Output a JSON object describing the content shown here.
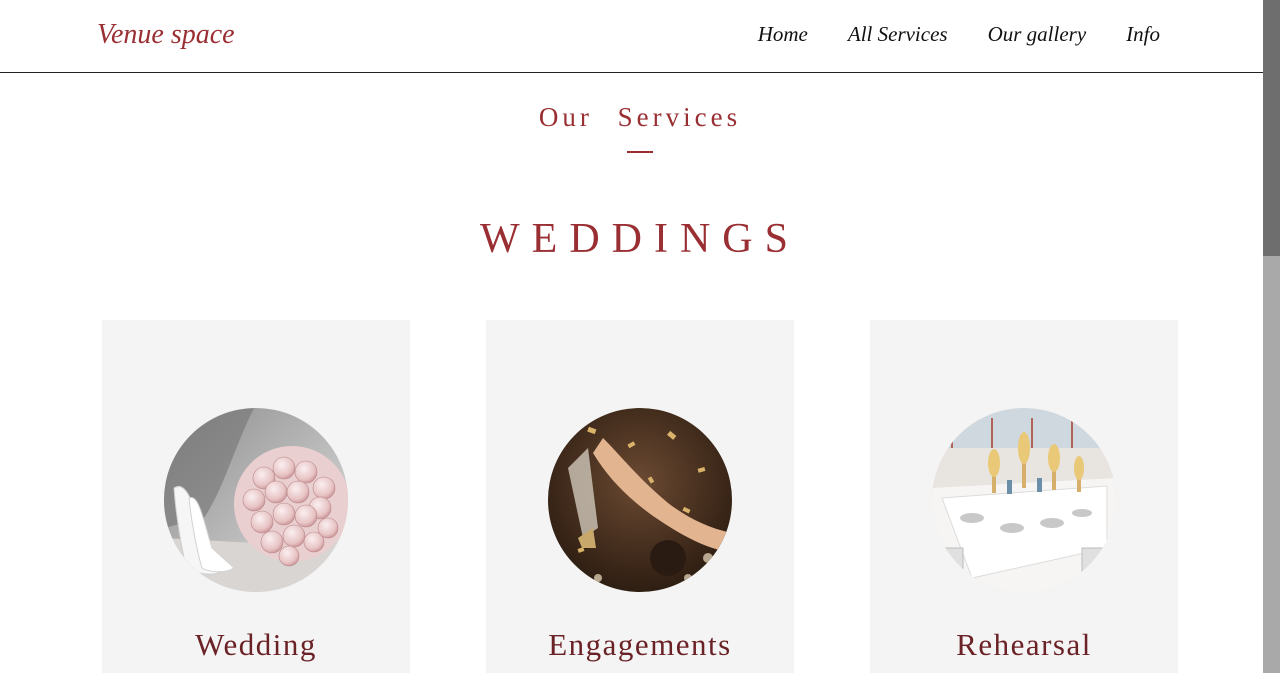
{
  "header": {
    "logo": "Venue space",
    "nav": [
      "Home",
      "All Services",
      "Our gallery",
      "Info"
    ]
  },
  "section": {
    "title": "Our Services",
    "category": "WEDDINGS"
  },
  "cards": [
    {
      "title": "Wedding",
      "image": "bridal-bouquet-shoes-photo"
    },
    {
      "title": "Engagements",
      "image": "champagne-toast-confetti-photo"
    },
    {
      "title": "Rehearsal",
      "image": "banquet-table-setting-photo"
    }
  ],
  "colors": {
    "accent": "#9a2f33",
    "card_title": "#6b2226",
    "card_bg": "#f4f4f4"
  }
}
